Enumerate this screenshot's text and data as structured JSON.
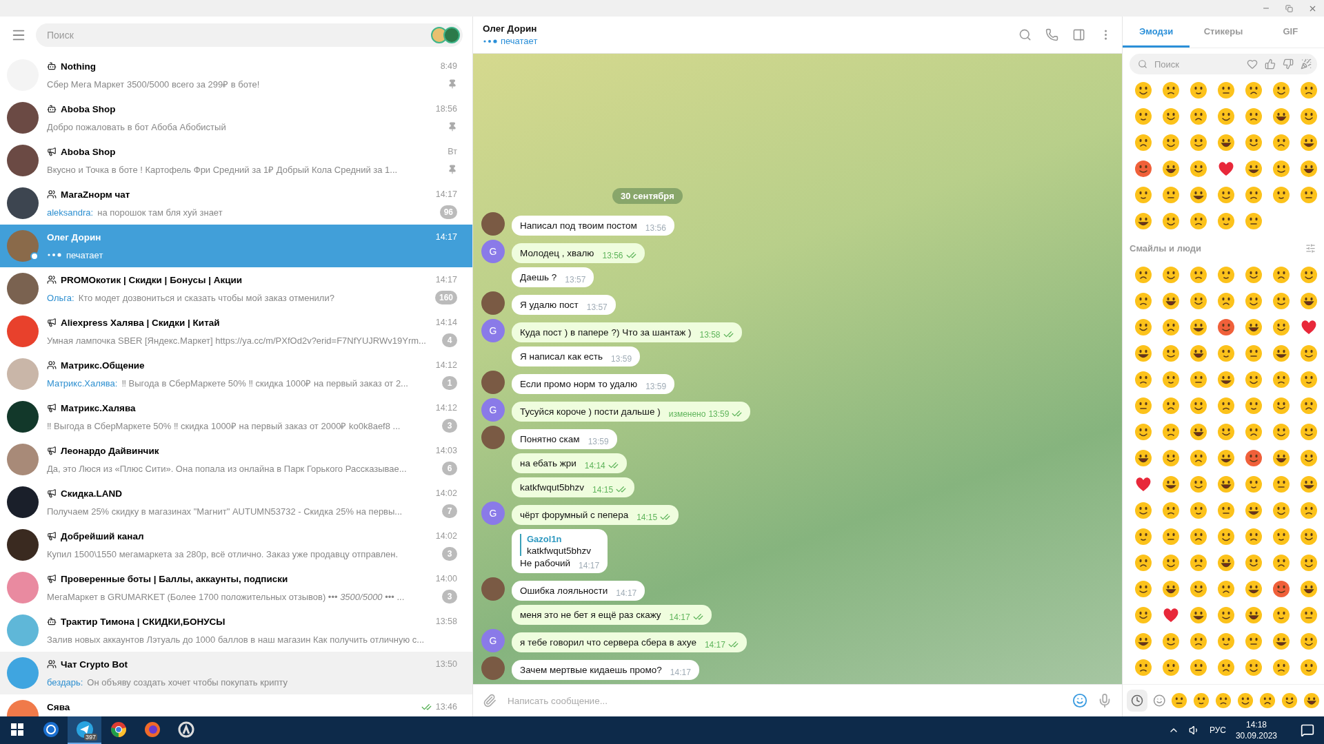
{
  "sidebar": {
    "search": {
      "placeholder": "Поиск"
    },
    "chats": [
      {
        "name": "Nothing",
        "kind": "bot",
        "time": "8:49",
        "preview": "Сбер Мега Маркет 3500/5000 всего за 299₽ в боте!",
        "pinned": true,
        "selected": false,
        "hovered": false,
        "online": false,
        "color": "#f4f4f4"
      },
      {
        "name": "Aboba Shop",
        "kind": "bot",
        "time": "18:56",
        "preview": "Добро пожаловать в бот Абоба Абобистый",
        "pinned": true,
        "selected": false,
        "hovered": false,
        "online": false,
        "color": "#6b4a44"
      },
      {
        "name": "Aboba Shop",
        "kind": "channel",
        "time": "Вт",
        "preview": "Вкусно и Точка в боте ! Картофель Фри Средний за 1₽ Добрый Кола Средний за 1...",
        "pinned": true,
        "selected": false,
        "hovered": false,
        "online": false,
        "color": "#6b4a44"
      },
      {
        "name": "МагаZнорм чат",
        "kind": "group",
        "time": "14:17",
        "sender": "aleksandra:",
        "preview": "на порошок там бля хуй знает",
        "badge": "96",
        "pinned": false,
        "selected": false,
        "hovered": false,
        "online": false,
        "color": "#3d4550"
      },
      {
        "name": "Олег Дорин",
        "kind": "user",
        "time": "14:17",
        "typing": "печатает",
        "pinned": false,
        "selected": true,
        "hovered": false,
        "online": true,
        "color": "#8a6a4a"
      },
      {
        "name": "PROMOкотик | Скидки | Бонусы | Акции",
        "kind": "group",
        "time": "14:17",
        "sender": "Ольга:",
        "preview": "Кто модет дозвониться и сказать чтобы мой заказ отменили?",
        "badge": "160",
        "pinned": false,
        "selected": false,
        "hovered": false,
        "online": false,
        "color": "#7a6250"
      },
      {
        "name": "Aliexpress Халява | Скидки | Китай",
        "kind": "channel",
        "time": "14:14",
        "preview": "Умная лампочка SBER [Яндекс.Маркет]  https://ya.cc/m/PXfOd2v?erid=F7NfYUJRWv19Yrm...",
        "badge": "4",
        "pinned": false,
        "selected": false,
        "hovered": false,
        "online": false,
        "color": "#e8412c"
      },
      {
        "name": "Матрикс.Общение",
        "kind": "group",
        "time": "14:12",
        "sender": "Матрикс.Халява:",
        "preview": "‼ Выгода в СберМаркете 50% ‼  скидка 1000₽ на первый заказ от 2...",
        "badge": "1",
        "pinned": false,
        "selected": false,
        "hovered": false,
        "online": false,
        "color": "#c9b6a8"
      },
      {
        "name": "Матрикс.Халява",
        "kind": "channel",
        "time": "14:12",
        "preview": "‼ Выгода в СберМаркете 50% ‼  скидка 1000₽ на первый заказ от 2000₽  ko0k8aef8 ...",
        "badge": "3",
        "pinned": false,
        "selected": false,
        "hovered": false,
        "online": false,
        "color": "#12382a"
      },
      {
        "name": "Леонардо Дайвинчик",
        "kind": "channel",
        "time": "14:03",
        "preview": "Да, это Люся из «Плюс Сити». Она попала из онлайна в Парк Горького   Рассказывае...",
        "badge": "6",
        "pinned": false,
        "selected": false,
        "hovered": false,
        "online": false,
        "color": "#a88a78"
      },
      {
        "name": "Скидка.LAND",
        "kind": "channel",
        "time": "14:02",
        "preview": "Получаем 25% скидку в магазинах \"Магнит\"  AUTUMN53732 - Скидка 25% на первы...",
        "badge": "7",
        "pinned": false,
        "selected": false,
        "hovered": false,
        "online": false,
        "color": "#1a1f2a"
      },
      {
        "name": "Добрейший канал",
        "kind": "channel",
        "time": "14:02",
        "preview": "Купил 1500\\1550 мегамаркета за 280р, всё отлично. Заказ уже продавцу отправлен.",
        "badge": "3",
        "pinned": false,
        "selected": false,
        "hovered": false,
        "online": false,
        "color": "#3a2a20"
      },
      {
        "name": "Проверенные боты | Баллы, аккаунты, подписки",
        "kind": "channel",
        "time": "14:00",
        "preview": "МегаМаркет в  GRUMARKET (Более 1700 положительных отзывов) ••• *3500/5000* ••• ...",
        "badge": "3",
        "pinned": false,
        "selected": false,
        "hovered": false,
        "online": false,
        "color": "#e98aa0"
      },
      {
        "name": "Трактир Тимона | СКИДКИ,БОНУСЫ",
        "kind": "bot",
        "time": "13:58",
        "preview": "Залив новых аккаунтов Лэтуаль до 1000 баллов в наш магазин  Как получить отличную с...",
        "pinned": false,
        "selected": false,
        "hovered": false,
        "online": false,
        "color": "#5fb7d8"
      },
      {
        "name": "Чат Crypto Bot",
        "kind": "group",
        "time": "13:50",
        "sender": "бездарь:",
        "preview": "Он объяву создать хочет чтобы покупать крипту",
        "pinned": false,
        "selected": false,
        "hovered": true,
        "online": false,
        "color": "#3fa5e0"
      },
      {
        "name": "Сява",
        "kind": "user",
        "time": "13:46",
        "read": true,
        "pinned": false,
        "selected": false,
        "hovered": false,
        "online": false,
        "color": "#f07a4a"
      }
    ]
  },
  "chat": {
    "title": "Олег Дорин",
    "status": "печатает",
    "date": "30 сентября",
    "input": {
      "placeholder": "Написать сообщение..."
    },
    "messages": [
      {
        "text": "Написал под твоим постом",
        "time": "13:56",
        "outgoing": false,
        "kind": "photo"
      },
      {
        "text": "Молодец , хвалю",
        "time": "13:56",
        "outgoing": true,
        "kind": "letter",
        "letter": "G"
      },
      {
        "text": "Даешь ?",
        "time": "13:57",
        "outgoing": false,
        "kind": "plain"
      },
      {
        "text": "Я удалю пост",
        "time": "13:57",
        "outgoing": false,
        "kind": "photo"
      },
      {
        "text": "Куда пост ) в папере ?) Что за шантаж )",
        "time": "13:58",
        "outgoing": true,
        "kind": "letter",
        "letter": "G"
      },
      {
        "text": "Я написал как есть",
        "time": "13:59",
        "outgoing": false,
        "kind": "plain"
      },
      {
        "text": "Если промо норм то удалю",
        "time": "13:59",
        "outgoing": false,
        "kind": "photo"
      },
      {
        "text": "Тусуйся короче ) пости дальше )",
        "edited": "изменено",
        "time": "13:59",
        "outgoing": true,
        "kind": "letter",
        "letter": "G"
      },
      {
        "text": "Понятно скам",
        "time": "13:59",
        "outgoing": false,
        "kind": "photo"
      },
      {
        "text": "на ебать жри",
        "time": "14:14",
        "outgoing": true,
        "kind": "plain"
      },
      {
        "text": "katkfwqut5bhzv",
        "time": "14:15",
        "outgoing": true,
        "kind": "plain"
      },
      {
        "text": "чёрт форумный с пепера",
        "time": "14:15",
        "outgoing": true,
        "kind": "letter",
        "letter": "G"
      },
      {
        "text": "Не рабочий",
        "time": "14:17",
        "outgoing": false,
        "kind": "plain",
        "reply": {
          "author": "Gazol1n",
          "text": "katkfwqut5bhzv"
        }
      },
      {
        "text": "Ошибка лояльности",
        "time": "14:17",
        "outgoing": false,
        "kind": "photo"
      },
      {
        "text": "меня это не бет я ещё раз скажу",
        "time": "14:17",
        "outgoing": true,
        "kind": "plain"
      },
      {
        "text": "я тебе говорил что сервера сбера в ахуе",
        "time": "14:17",
        "outgoing": true,
        "kind": "letter",
        "letter": "G"
      },
      {
        "text": "Зачем мертвые кидаешь промо?",
        "time": "14:17",
        "outgoing": false,
        "kind": "photo"
      }
    ]
  },
  "emoji_panel": {
    "tabs": [
      {
        "label": "Эмодзи",
        "selected": true
      },
      {
        "label": "Стикеры",
        "selected": false
      },
      {
        "label": "GIF",
        "selected": false
      }
    ],
    "search": {
      "placeholder": "Поиск"
    },
    "section": "Смайлы и люди"
  },
  "taskbar": {
    "apps": [
      {
        "kind": "windows",
        "selected": false
      },
      {
        "kind": "battlenet",
        "selected": false
      },
      {
        "kind": "telegram",
        "selected": true,
        "badge": "397"
      },
      {
        "kind": "chrome",
        "selected": false
      },
      {
        "kind": "firefox",
        "selected": false
      },
      {
        "kind": "overwatch",
        "selected": false
      }
    ],
    "language": "РУС",
    "time": "14:18",
    "date": "30.09.2023"
  }
}
